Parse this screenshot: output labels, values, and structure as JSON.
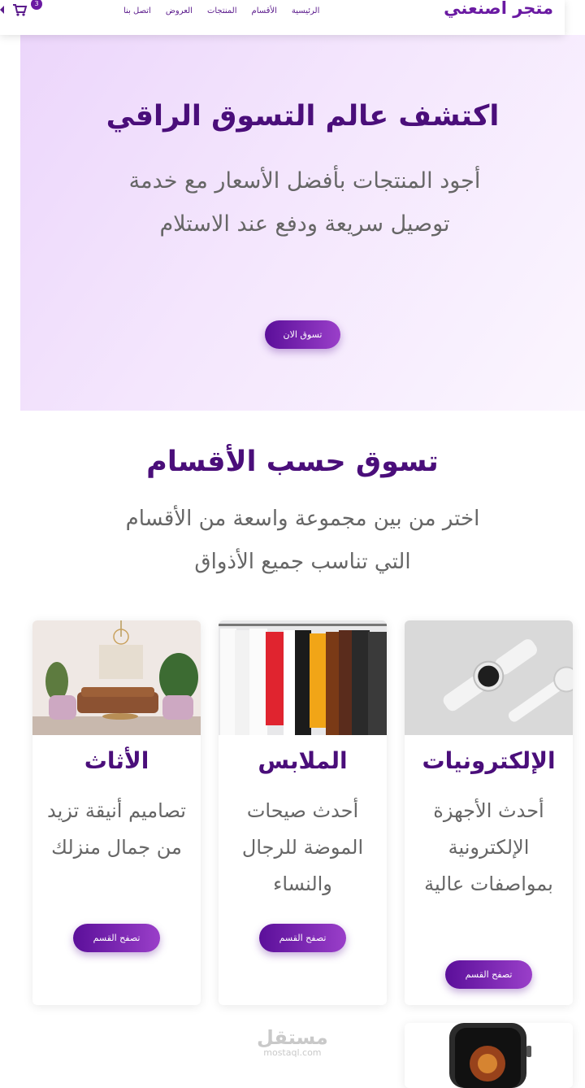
{
  "header": {
    "brand": "متجر اصنعني",
    "menu": [
      "الرئيسية",
      "الأقسام",
      "المنتجات",
      "العروض",
      "اتصل بنا"
    ],
    "cart_count": "3"
  },
  "hero": {
    "title": "اكتشف عالم التسوق الراقي",
    "subtitle": "أجود المنتجات بأفضل الأسعار مع خدمة توصيل سريعة ودفع عند الاستلام",
    "cta": "تسوق الان"
  },
  "categories_section": {
    "title": "تسوق حسب الأقسام",
    "subtitle": "اختر من بين مجموعة واسعة من الأقسام التي تناسب جميع الأذواق",
    "cards": [
      {
        "title": "الإلكترونيات",
        "description": "أحدث الأجهزة الإلكترونية بمواصفات عالية",
        "button": "تصفح القسم",
        "image": "smartwatch-image"
      },
      {
        "title": "الملابس",
        "description": "أحدث صيحات الموضة للرجال والنساء",
        "button": "تصفح القسم",
        "image": "clothes-rack-image"
      },
      {
        "title": "الأثاث",
        "description": "تصاميم أنيقة تزيد من جمال منزلك",
        "button": "تصفح القسم",
        "image": "living-room-image"
      }
    ]
  },
  "watermark": {
    "arabic": "مستقل",
    "latin": "mostaql.com"
  },
  "colors": {
    "accent": "#4a0e7a",
    "button_start": "#5b0f9a",
    "button_end": "#9a3fc9",
    "hero_bg": "#ecd6fb"
  }
}
